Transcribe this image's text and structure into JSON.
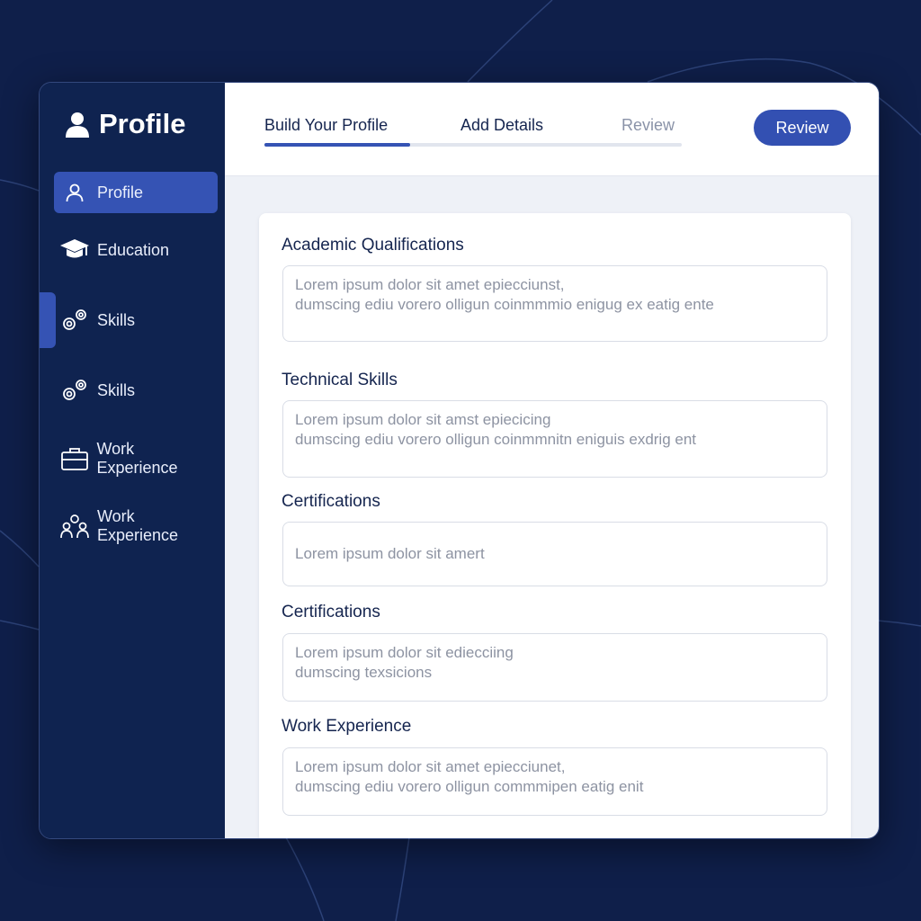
{
  "sidebar": {
    "title": "Profile",
    "title_icon": "user-icon",
    "items": [
      {
        "label": "Profile",
        "icon": "user-outline-icon",
        "active": true
      },
      {
        "label": "Education",
        "icon": "graduation-cap-icon"
      },
      {
        "label": "Skills",
        "icon": "gears-icon"
      },
      {
        "label": "Skills",
        "icon": "gears-icon"
      },
      {
        "label": "Work Experience",
        "icon": "briefcase-icon"
      },
      {
        "label": "Work Experience",
        "icon": "team-icon"
      }
    ]
  },
  "steps": {
    "items": [
      {
        "label": "Build Your Profile",
        "state": "active"
      },
      {
        "label": "Add Details",
        "state": "current"
      },
      {
        "label": "Review",
        "state": "pending"
      }
    ],
    "progress": 0.35
  },
  "review_button": {
    "label": "Review"
  },
  "form": {
    "fields": [
      {
        "label": "Academic Qualifications",
        "line1": "Lorem ipsum dolor sit amet epiecciunst,",
        "line2": "dumscing ediu vorero olligun coinmmmio enigug ex eatig ente"
      },
      {
        "label": "Technical Skills",
        "line1": "Lorem ipsum dolor sit amst epiecicing",
        "line2": "dumscing ediu vorero olligun coinmmnitn eniguis exdrig ent"
      },
      {
        "label": "Certifications",
        "line1": "Lorem ipsum dolor sit amert"
      },
      {
        "label": "Certifications",
        "line1": "Lorem ipsum dolor sit ediecciing",
        "line2": "dumscing texsicions"
      },
      {
        "label": "Work Experience",
        "line1": "Lorem ipsum dolor sit amet epiecciunet,",
        "line2": "dumscing ediu vorero olligun commmipen eatig enit"
      }
    ]
  },
  "colors": {
    "background": "#0f1f4a",
    "sidebar": "#0f2350",
    "accent": "#3553b4",
    "content_bg": "#eef1f7"
  }
}
